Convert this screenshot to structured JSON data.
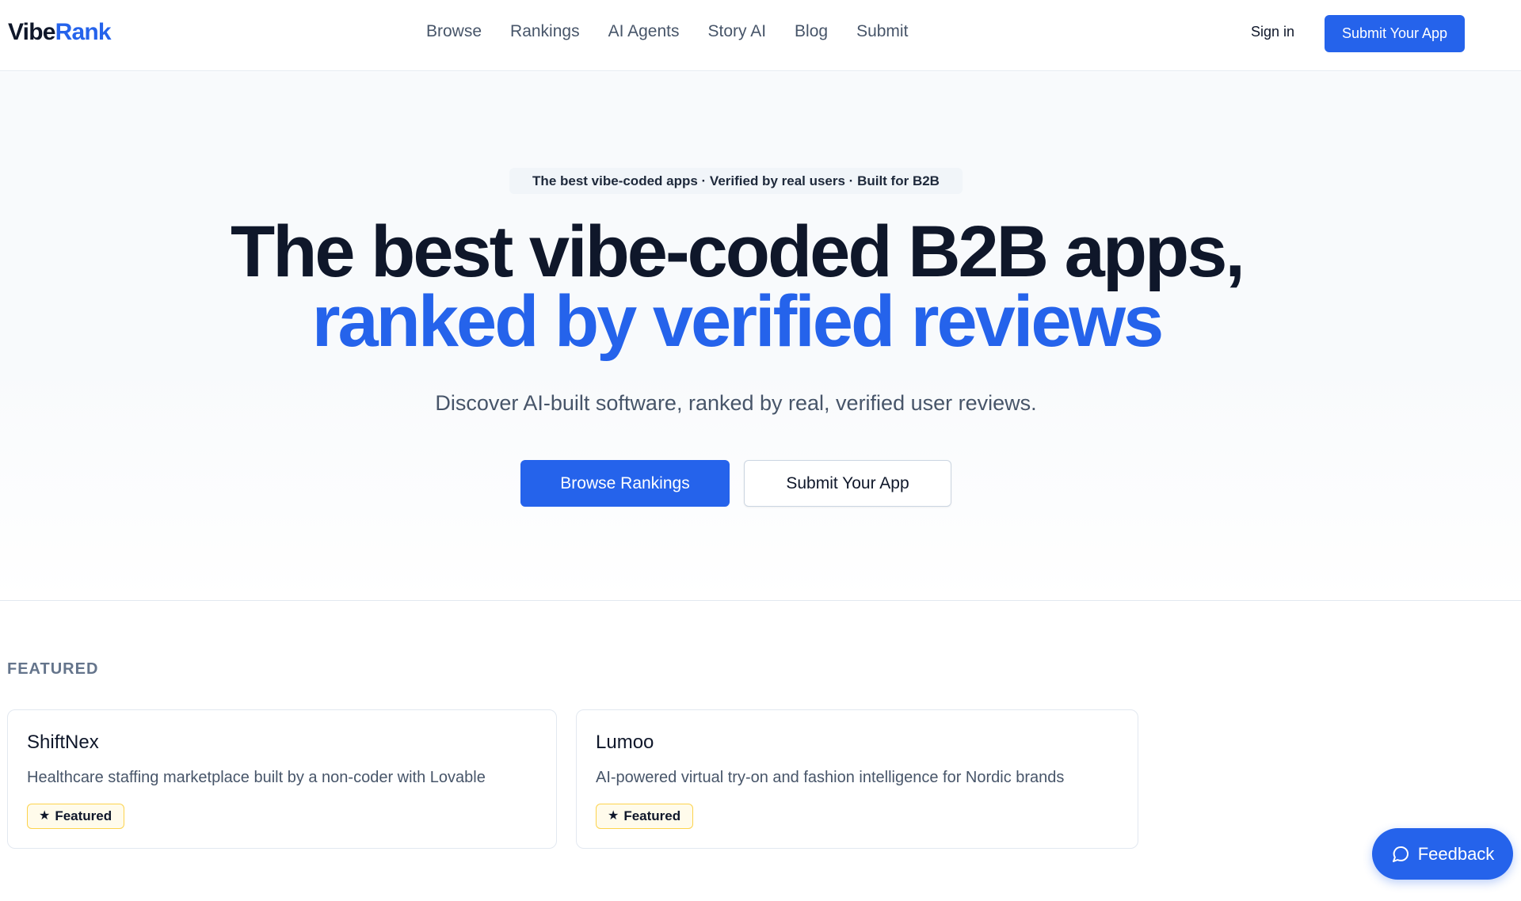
{
  "brand": {
    "part1": "Vibe",
    "part2": "Rank"
  },
  "nav": {
    "items": [
      {
        "label": "Browse"
      },
      {
        "label": "Rankings"
      },
      {
        "label": "AI Agents"
      },
      {
        "label": "Story AI"
      },
      {
        "label": "Blog"
      },
      {
        "label": "Submit"
      }
    ],
    "sign_in": "Sign in",
    "cta": "Submit Your App"
  },
  "hero": {
    "eyebrow": "The best vibe-coded apps · Verified by real users · Built for B2B",
    "headline_line1": "The best vibe-coded B2B apps,",
    "headline_line2": "ranked by verified reviews",
    "subhead": "Discover AI-built software, ranked by real, verified user reviews.",
    "primary_button": "Browse Rankings",
    "secondary_button": "Submit Your App"
  },
  "featured": {
    "label": "FEATURED",
    "cards": [
      {
        "title": "ShiftNex",
        "description": "Healthcare staffing marketplace built by a non-coder with Lovable",
        "badge": "Featured"
      },
      {
        "title": "Lumoo",
        "description": "AI-powered virtual try-on and fashion intelligence for Nordic brands",
        "badge": "Featured"
      }
    ]
  },
  "feedback": {
    "label": "Feedback"
  },
  "colors": {
    "accent": "#2563eb",
    "text": "#0f172a",
    "muted": "#475569",
    "badge_bg": "#fffbeb",
    "badge_border": "#fcd34d"
  },
  "icons": {
    "badge": "star-icon",
    "feedback": "chat-bubble-icon"
  }
}
